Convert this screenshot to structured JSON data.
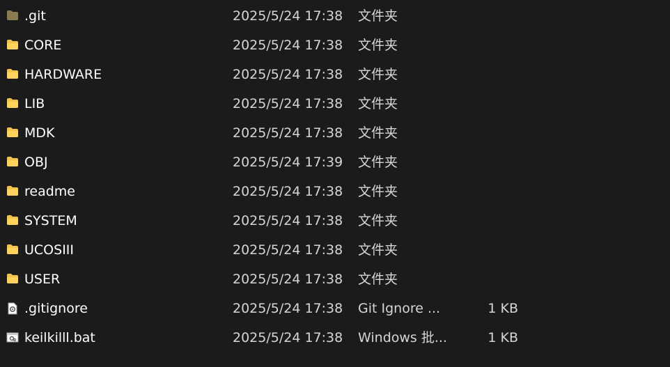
{
  "files": [
    {
      "name": ".git",
      "modified": "2025/5/24 17:38",
      "type": "文件夹",
      "size": "",
      "icon": "folder-dim-icon"
    },
    {
      "name": "CORE",
      "modified": "2025/5/24 17:38",
      "type": "文件夹",
      "size": "",
      "icon": "folder-icon"
    },
    {
      "name": "HARDWARE",
      "modified": "2025/5/24 17:38",
      "type": "文件夹",
      "size": "",
      "icon": "folder-icon"
    },
    {
      "name": "LIB",
      "modified": "2025/5/24 17:38",
      "type": "文件夹",
      "size": "",
      "icon": "folder-icon"
    },
    {
      "name": "MDK",
      "modified": "2025/5/24 17:38",
      "type": "文件夹",
      "size": "",
      "icon": "folder-icon"
    },
    {
      "name": "OBJ",
      "modified": "2025/5/24 17:39",
      "type": "文件夹",
      "size": "",
      "icon": "folder-icon"
    },
    {
      "name": "readme",
      "modified": "2025/5/24 17:38",
      "type": "文件夹",
      "size": "",
      "icon": "folder-icon"
    },
    {
      "name": "SYSTEM",
      "modified": "2025/5/24 17:38",
      "type": "文件夹",
      "size": "",
      "icon": "folder-icon"
    },
    {
      "name": "UCOSIII",
      "modified": "2025/5/24 17:38",
      "type": "文件夹",
      "size": "",
      "icon": "folder-icon"
    },
    {
      "name": "USER",
      "modified": "2025/5/24 17:38",
      "type": "文件夹",
      "size": "",
      "icon": "folder-icon"
    },
    {
      "name": ".gitignore",
      "modified": "2025/5/24 17:38",
      "type": "Git Ignore ...",
      "size": "1 KB",
      "icon": "gear-file-icon"
    },
    {
      "name": "keilkilll.bat",
      "modified": "2025/5/24 17:38",
      "type": "Windows 批...",
      "size": "1 KB",
      "icon": "batch-file-icon"
    }
  ],
  "colors": {
    "background": "#1b1b1b",
    "folder": "#f5c24b",
    "folder_dim": "#8a7a52"
  }
}
